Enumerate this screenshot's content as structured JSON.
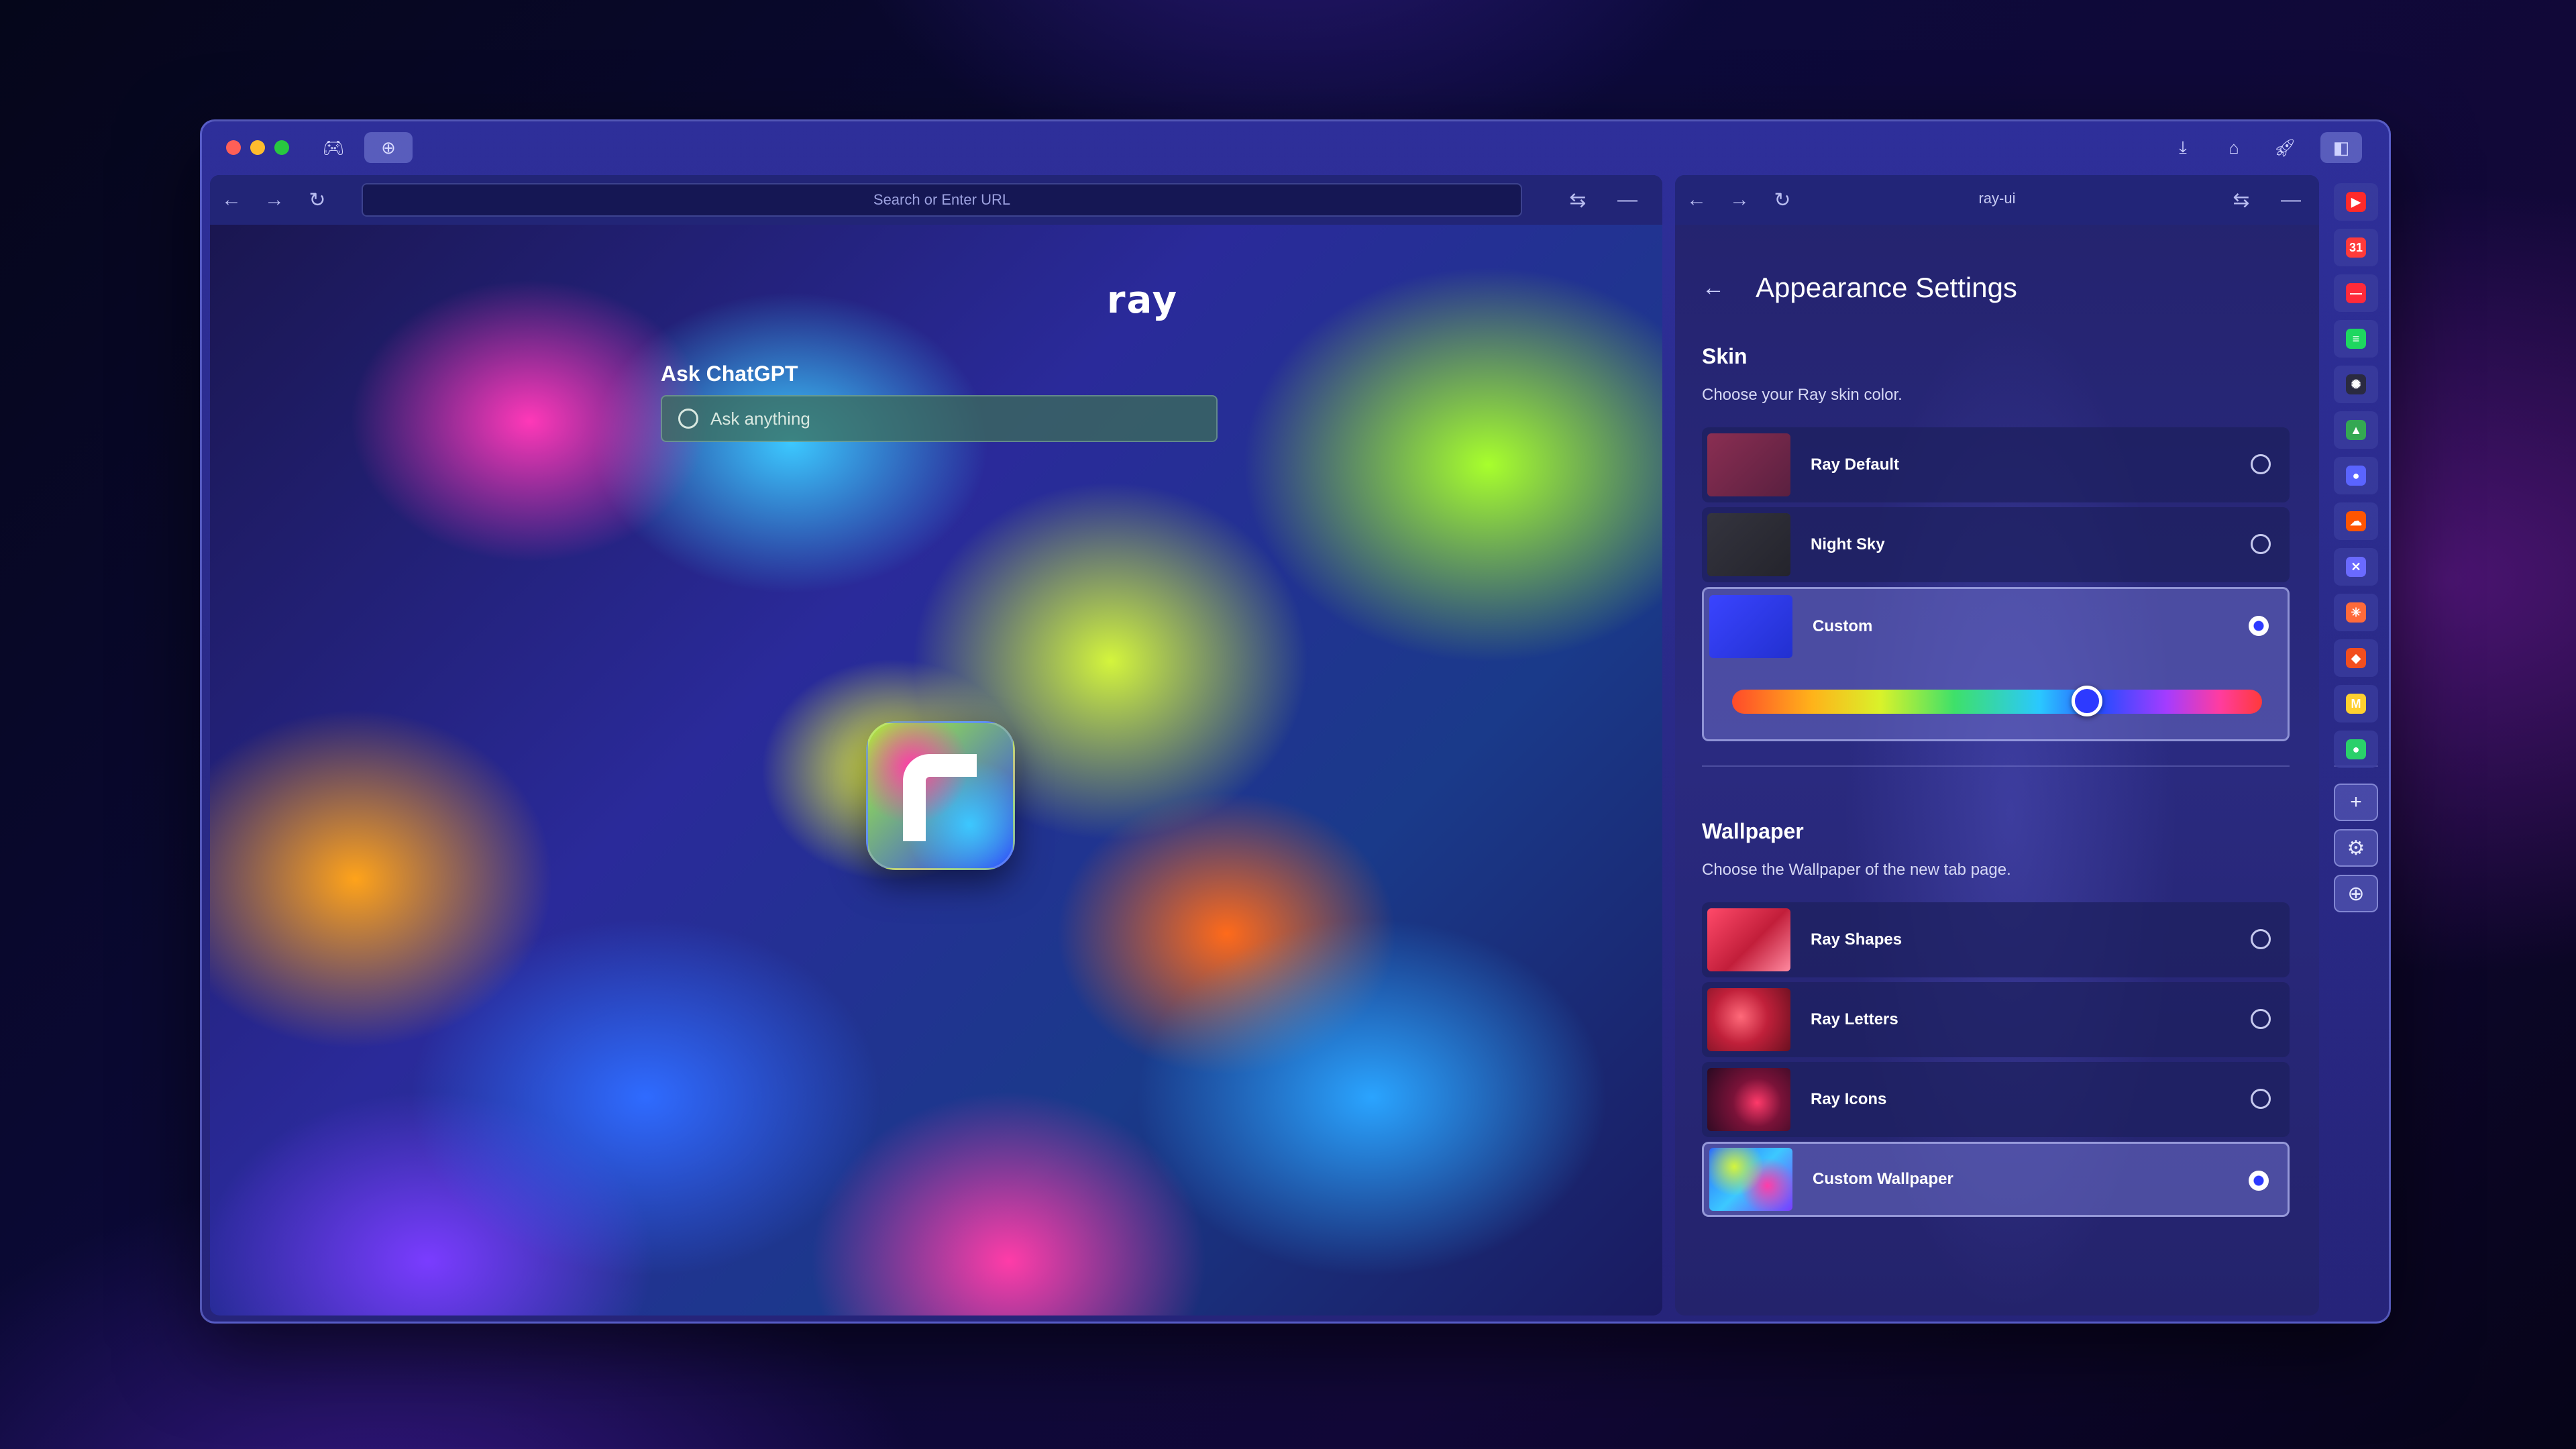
{
  "browser": {
    "url_placeholder": "Search or Enter URL",
    "right_pane_title": "ray-ui"
  },
  "new_tab": {
    "logo_text": "ray",
    "ask_title": "Ask ChatGPT",
    "ask_placeholder": "Ask anything"
  },
  "settings": {
    "title": "Appearance Settings",
    "skin": {
      "title": "Skin",
      "subtitle": "Choose your Ray skin color.",
      "options": [
        {
          "label": "Ray Default",
          "color": "#7a2a4a",
          "selected": false
        },
        {
          "label": "Night Sky",
          "color": "#2c2c38",
          "selected": false
        },
        {
          "label": "Custom",
          "color": "#2d3aff",
          "selected": true
        }
      ],
      "custom_hue_fraction": 0.67
    },
    "wallpaper": {
      "title": "Wallpaper",
      "subtitle": "Choose the Wallpaper of the new tab page.",
      "options": [
        {
          "label": "Ray Shapes",
          "selected": false
        },
        {
          "label": "Ray Letters",
          "selected": false
        },
        {
          "label": "Ray Icons",
          "selected": false
        },
        {
          "label": "Custom Wallpaper",
          "selected": true
        }
      ]
    }
  },
  "sidebar": {
    "apps": [
      {
        "icon": "youtube-icon",
        "glyph": "▶",
        "color": "#ff2a2a"
      },
      {
        "icon": "calendar-icon",
        "glyph": "31",
        "color": "#ff3a3a"
      },
      {
        "icon": "red-app-icon",
        "glyph": "—",
        "color": "#ff2a3a"
      },
      {
        "icon": "spotify-icon",
        "glyph": "≡",
        "color": "#1ed760"
      },
      {
        "icon": "openai-icon",
        "glyph": "✺",
        "color": "#2a2a40"
      },
      {
        "icon": "google-drive-icon",
        "glyph": "▲",
        "color": "#34a853"
      },
      {
        "icon": "blue-app-icon",
        "glyph": "●",
        "color": "#5a64ff"
      },
      {
        "icon": "soundcloud-icon",
        "glyph": "☁",
        "color": "#ff5500"
      },
      {
        "icon": "x-app-icon",
        "glyph": "✕",
        "color": "#6a6aff"
      },
      {
        "icon": "claude-icon",
        "glyph": "✳",
        "color": "#ff6a3a"
      },
      {
        "icon": "figma-icon",
        "glyph": "◆",
        "color": "#f24e1e"
      },
      {
        "icon": "miro-icon",
        "glyph": "M",
        "color": "#ffd02f"
      },
      {
        "icon": "green-app-icon",
        "glyph": "●",
        "color": "#2ad06a"
      }
    ]
  }
}
